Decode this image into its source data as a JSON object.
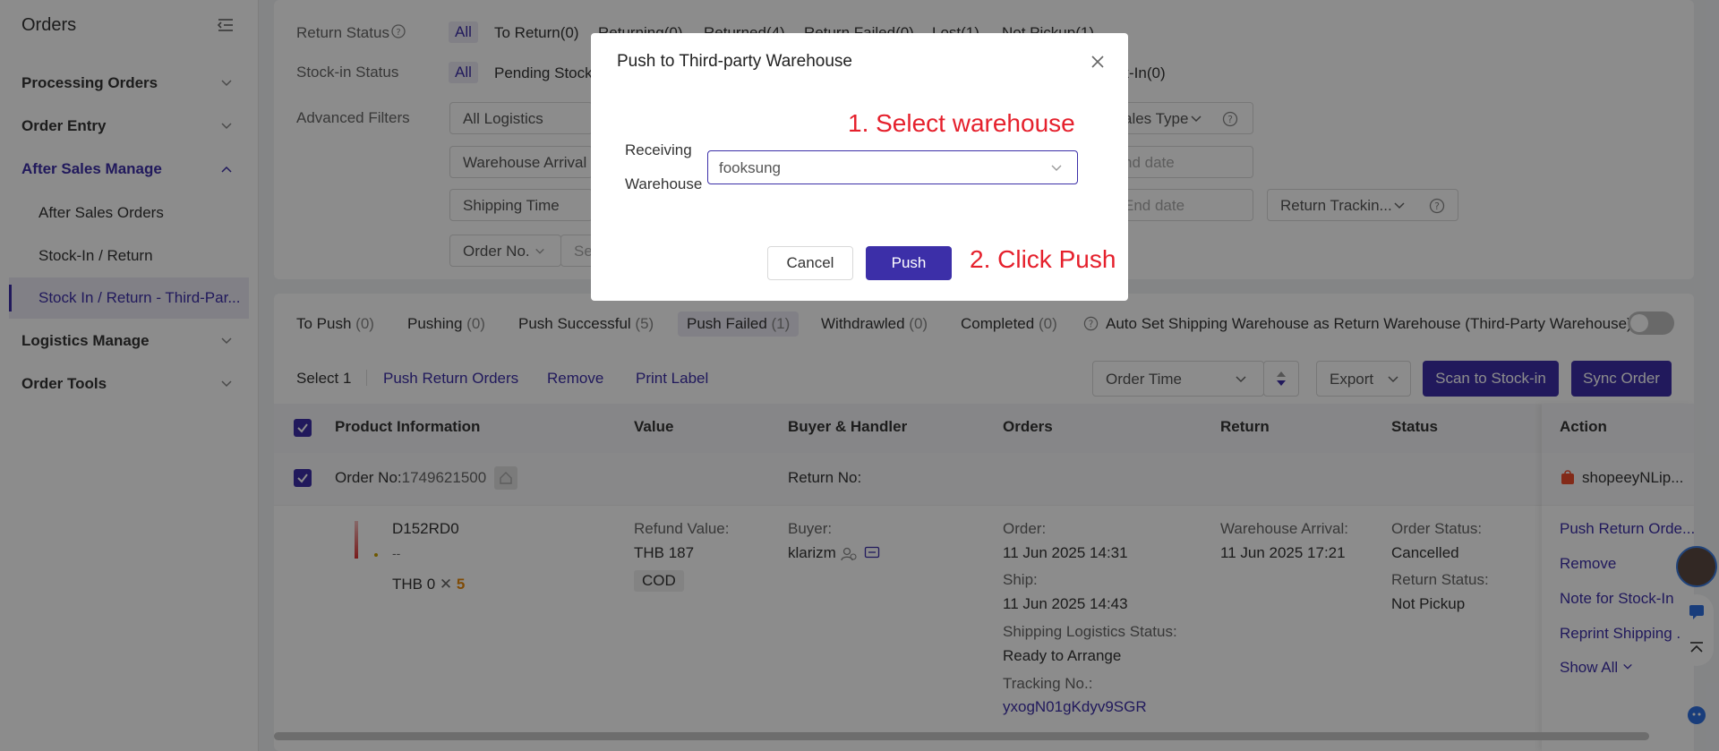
{
  "sidebar": {
    "title": "Orders",
    "items": [
      {
        "label": "Processing Orders"
      },
      {
        "label": "Order Entry"
      },
      {
        "label": "After Sales Manage"
      },
      {
        "label": "Logistics Manage"
      },
      {
        "label": "Order Tools"
      }
    ],
    "sub_items": [
      {
        "label": "After Sales Orders"
      },
      {
        "label": "Stock-In / Return"
      },
      {
        "label": "Stock In / Return - Third-Par..."
      }
    ]
  },
  "filters": {
    "return_status_label": "Return Status",
    "return_status_options": [
      "All",
      "To Return",
      "Returning",
      "Returned",
      "Return Failed",
      "Lost",
      "Not Pickup"
    ],
    "return_status_counts": [
      "",
      "(0)",
      "(0)",
      "(4)",
      "(0)",
      "(1)",
      "(1)"
    ],
    "stockin_status_label": "Stock-in Status",
    "stockin_all": "All",
    "stockin_pending": "Pending Stock",
    "stockin_tail": "ck-In(0)",
    "advanced_label": "Advanced Filters",
    "all_logistics": "All Logistics",
    "sales_type": "ales Type",
    "warehouse_arrival": "Warehouse Arrival T",
    "end_date": "nd date",
    "shipping_time": "Shipping Time",
    "end_date2": "End date",
    "return_tracking": "Return Trackin...",
    "order_no": "Order No.",
    "search_stub": "Se"
  },
  "tabs": [
    {
      "label": "To Push",
      "count": "(0)"
    },
    {
      "label": "Pushing",
      "count": "(0)"
    },
    {
      "label": "Push Successful",
      "count": "(5)"
    },
    {
      "label": "Push Failed",
      "count": "(1)"
    },
    {
      "label": "Withdrawled",
      "count": "(0)"
    },
    {
      "label": "Completed",
      "count": "(0)"
    }
  ],
  "auto_set_label": "Auto Set Shipping Warehouse as Return Warehouse (Third-Party Warehouse)",
  "toolbar": {
    "select_count": "Select 1",
    "push_return_orders": "Push Return Orders",
    "remove": "Remove",
    "print_label": "Print Label",
    "sort_field": "Order Time",
    "export": "Export",
    "scan": "Scan to Stock-in",
    "sync": "Sync Order"
  },
  "table": {
    "headers": [
      "Product Information",
      "Value",
      "Buyer & Handler",
      "Orders",
      "Return",
      "Status",
      "Action"
    ],
    "order_no_label": "Order No:",
    "order_no_value": "1749621500",
    "return_no_label": "Return No:",
    "shop_name": "shopeeyNLip...",
    "product_sku": "D152RD0",
    "product_dash": "--",
    "product_price": "THB 0",
    "product_qty": "5",
    "refund_label": "Refund Value:",
    "refund_value": "THB 187",
    "payment_badge": "COD",
    "buyer_label": "Buyer:",
    "buyer_name": "klarizm",
    "order_label": "Order:",
    "order_time": "11 Jun 2025 14:31",
    "ship_label": "Ship:",
    "ship_time": "11 Jun 2025 14:43",
    "logistics_status_label": "Shipping Logistics Status:",
    "logistics_status_value": "Ready to Arrange",
    "tracking_label": "Tracking No.:",
    "tracking_value": "yxogN01gKdyv9SGR",
    "arrival_label": "Warehouse Arrival:",
    "arrival_time": "11 Jun 2025 17:21",
    "order_status_label": "Order Status:",
    "order_status_value": "Cancelled",
    "return_status_label": "Return Status:",
    "return_status_value": "Not Pickup",
    "actions": [
      "Push Return Orde...",
      "Remove",
      "Note for Stock-In",
      "Reprint Shipping ...",
      "Show All"
    ]
  },
  "modal": {
    "title": "Push to Third-party Warehouse",
    "field_label_1": "Receiving",
    "field_label_2": "Warehouse",
    "warehouse_value": "fooksung",
    "cancel": "Cancel",
    "push": "Push",
    "annotation_1": "1. Select warehouse",
    "annotation_2": "2. Click Push"
  },
  "colors": {
    "primary": "#3c2fa8",
    "annotation": "#e5202c"
  }
}
